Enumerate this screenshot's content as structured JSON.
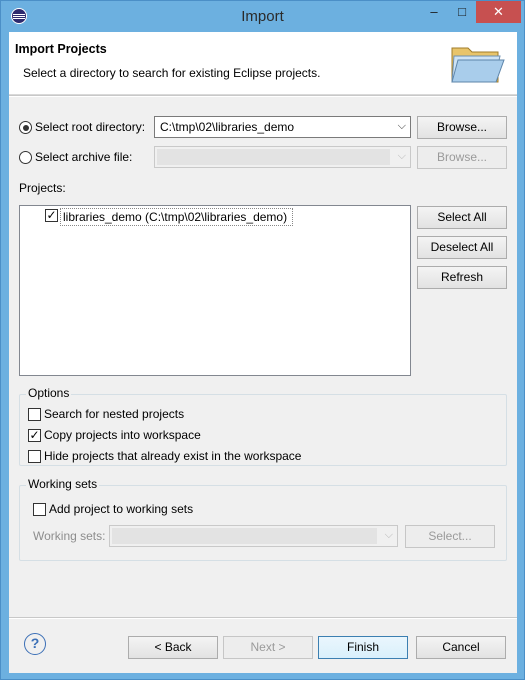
{
  "window": {
    "title": "Import",
    "minimize_glyph": "–",
    "maximize_glyph": "□",
    "close_glyph": "✕",
    "app_icon": "eclipse-icon"
  },
  "header": {
    "title": "Import Projects",
    "description": "Select a directory to search for existing Eclipse projects.",
    "icon": "folder-open-icon"
  },
  "source": {
    "root_directory": {
      "label": "Select root directory:",
      "selected": true,
      "value": "C:\\tmp\\02\\libraries_demo",
      "browse_label": "Browse..."
    },
    "archive_file": {
      "label": "Select archive file:",
      "selected": false,
      "value": "",
      "browse_label": "Browse..."
    }
  },
  "projects": {
    "label": "Projects:",
    "items": [
      {
        "label": "libraries_demo (C:\\tmp\\02\\libraries_demo)",
        "checked": true
      }
    ],
    "select_all_label": "Select All",
    "deselect_all_label": "Deselect All",
    "refresh_label": "Refresh"
  },
  "options": {
    "title": "Options",
    "search_nested": {
      "label": "Search for nested projects",
      "checked": false
    },
    "copy_into_workspace": {
      "label": "Copy projects into workspace",
      "checked": true
    },
    "hide_existing": {
      "label": "Hide projects that already exist in the workspace",
      "checked": false
    }
  },
  "working_sets": {
    "title": "Working sets",
    "add_to_working_sets": {
      "label": "Add project to working sets",
      "checked": false
    },
    "working_sets_label": "Working sets:",
    "select_label": "Select..."
  },
  "footer": {
    "help_glyph": "?",
    "back_label": "< Back",
    "next_label": "Next >",
    "finish_label": "Finish",
    "cancel_label": "Cancel"
  },
  "colors": {
    "title_bar": "#6cb0e0",
    "close_button": "#c75050",
    "dialog_background": "#f0f0f0",
    "default_button_border": "#3c7fb1"
  }
}
